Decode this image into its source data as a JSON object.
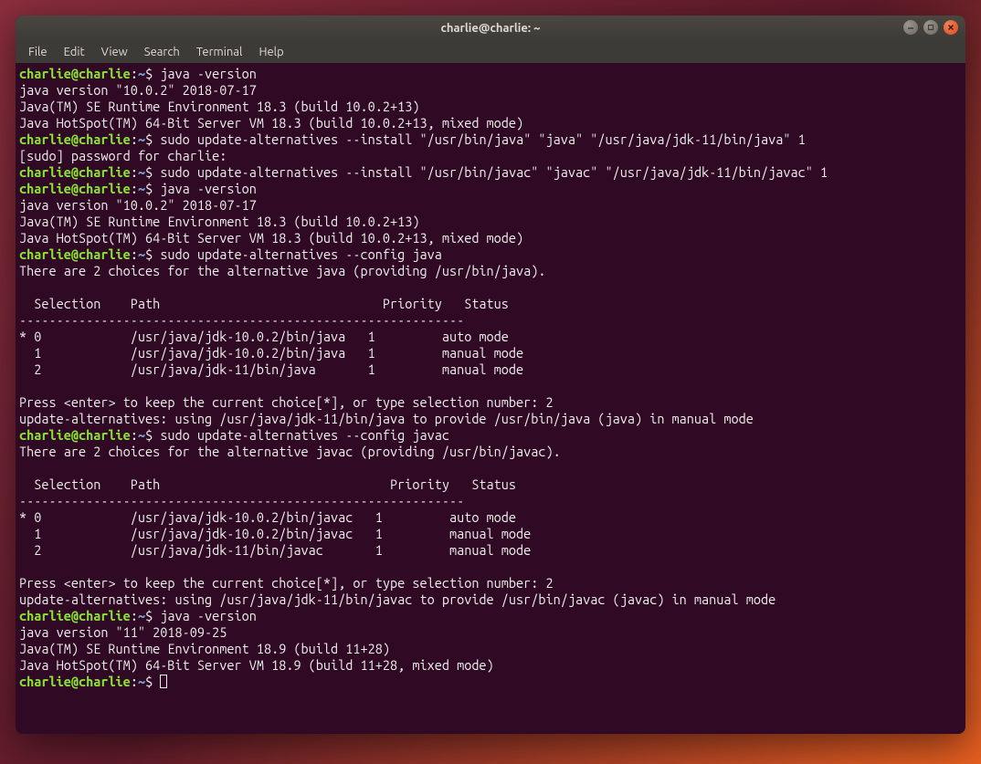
{
  "titlebar": {
    "title": "charlie@charlie: ~"
  },
  "menubar": {
    "items": [
      "File",
      "Edit",
      "View",
      "Search",
      "Terminal",
      "Help"
    ]
  },
  "prompt": {
    "user": "charlie@charlie",
    "colon": ":",
    "path": "~",
    "dollar": "$ "
  },
  "lines": {
    "cmd1": "java -version",
    "out1_1": "java version \"10.0.2\" 2018-07-17",
    "out1_2": "Java(TM) SE Runtime Environment 18.3 (build 10.0.2+13)",
    "out1_3": "Java HotSpot(TM) 64-Bit Server VM 18.3 (build 10.0.2+13, mixed mode)",
    "cmd2": "sudo update-alternatives --install \"/usr/bin/java\" \"java\" \"/usr/java/jdk-11/bin/java\" 1",
    "out2_1": "[sudo] password for charlie: ",
    "cmd3": "sudo update-alternatives --install \"/usr/bin/javac\" \"javac\" \"/usr/java/jdk-11/bin/javac\" 1",
    "cmd4": "java -version",
    "out4_1": "java version \"10.0.2\" 2018-07-17",
    "out4_2": "Java(TM) SE Runtime Environment 18.3 (build 10.0.2+13)",
    "out4_3": "Java HotSpot(TM) 64-Bit Server VM 18.3 (build 10.0.2+13, mixed mode)",
    "cmd5": "sudo update-alternatives --config java",
    "out5_1": "There are 2 choices for the alternative java (providing /usr/bin/java).",
    "out5_blank": "",
    "out5_header": "  Selection    Path                              Priority   Status",
    "out5_sep": "------------------------------------------------------------",
    "out5_r0": "* 0            /usr/java/jdk-10.0.2/bin/java   1         auto mode",
    "out5_r1": "  1            /usr/java/jdk-10.0.2/bin/java   1         manual mode",
    "out5_r2": "  2            /usr/java/jdk-11/bin/java       1         manual mode",
    "out5_prompt": "Press <enter> to keep the current choice[*], or type selection number: 2",
    "out5_result": "update-alternatives: using /usr/java/jdk-11/bin/java to provide /usr/bin/java (java) in manual mode",
    "cmd6": "sudo update-alternatives --config javac",
    "out6_1": "There are 2 choices for the alternative javac (providing /usr/bin/javac).",
    "out6_header": "  Selection    Path                               Priority   Status",
    "out6_sep": "------------------------------------------------------------",
    "out6_r0": "* 0            /usr/java/jdk-10.0.2/bin/javac   1         auto mode",
    "out6_r1": "  1            /usr/java/jdk-10.0.2/bin/javac   1         manual mode",
    "out6_r2": "  2            /usr/java/jdk-11/bin/javac       1         manual mode",
    "out6_prompt": "Press <enter> to keep the current choice[*], or type selection number: 2",
    "out6_result": "update-alternatives: using /usr/java/jdk-11/bin/javac to provide /usr/bin/javac (javac) in manual mode",
    "cmd7": "java -version",
    "out7_1": "java version \"11\" 2018-09-25",
    "out7_2": "Java(TM) SE Runtime Environment 18.9 (build 11+28)",
    "out7_3": "Java HotSpot(TM) 64-Bit Server VM 18.9 (build 11+28, mixed mode)"
  }
}
